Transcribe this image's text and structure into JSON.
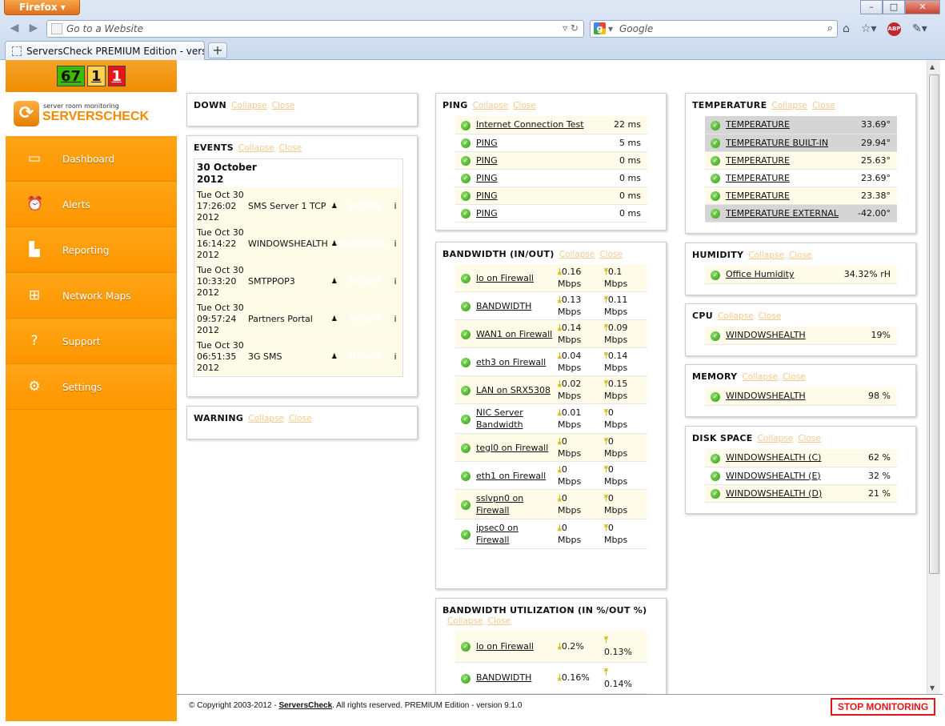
{
  "browser": {
    "menu_button": "Firefox",
    "url_placeholder": "Go to a Website",
    "search_placeholder": "Google",
    "tab_title": "ServersCheck PREMIUM Edition - versio...",
    "new_tab": "+",
    "abp": "ABP"
  },
  "counts": {
    "ok": "67",
    "warning": "1",
    "down": "1"
  },
  "logo": {
    "tagline": "server room monitoring",
    "name": "SERVERSCHECK"
  },
  "nav": [
    {
      "label": "Dashboard",
      "icon": "monitor-icon"
    },
    {
      "label": "Alerts",
      "icon": "alarm-clock-icon"
    },
    {
      "label": "Reporting",
      "icon": "bar-chart-icon"
    },
    {
      "label": "Network Maps",
      "icon": "network-icon"
    },
    {
      "label": "Support",
      "icon": "help-icon"
    },
    {
      "label": "Settings",
      "icon": "gear-icon"
    }
  ],
  "links": {
    "collapse": "Collapse",
    "close": "Close"
  },
  "down": {
    "title": "DOWN"
  },
  "events": {
    "title": "EVENTS",
    "date": "30 October 2012",
    "rows": [
      {
        "d1": "Tue Oct 30",
        "d2": "17:26:02",
        "d3": "2012",
        "name": "SMS Server 1 TCP",
        "status": "DOWN"
      },
      {
        "d1": "Tue Oct 30",
        "d2": "16:14:22",
        "d3": "2012",
        "name": "WINDOWSHEALTH",
        "status": "WARNING"
      },
      {
        "d1": "Tue Oct 30",
        "d2": "10:33:20",
        "d3": "2012",
        "name": "SMTPPOP3",
        "status": "DOWN"
      },
      {
        "d1": "Tue Oct 30",
        "d2": "09:57:24",
        "d3": "2012",
        "name": "Partners Portal",
        "status": "DOWN"
      },
      {
        "d1": "Tue Oct 30",
        "d2": "06:51:35",
        "d3": "2012",
        "name": "3G SMS",
        "status": "DOWN"
      }
    ],
    "info": "i"
  },
  "warning": {
    "title": "WARNING"
  },
  "ping": {
    "title": "PING",
    "rows": [
      {
        "name": "Internet Connection Test",
        "value": "22 ms"
      },
      {
        "name": "PING",
        "value": "5 ms"
      },
      {
        "name": "PING",
        "value": "0 ms"
      },
      {
        "name": "PING",
        "value": "0 ms"
      },
      {
        "name": "PING",
        "value": "0 ms"
      },
      {
        "name": "PING",
        "value": "0 ms"
      }
    ]
  },
  "bandwidth": {
    "title": "BANDWIDTH (IN/OUT)",
    "rows": [
      {
        "name1": "lo on Firewall",
        "name2": "",
        "in": "0.16",
        "out": "0.1",
        "unit": "Mbps"
      },
      {
        "name1": "BANDWIDTH",
        "name2": "",
        "in": "0.13",
        "out": "0.11",
        "unit": "Mbps"
      },
      {
        "name1": "WAN1 on Firewall",
        "name2": "",
        "in": "0.14",
        "out": "0.09",
        "unit": "Mbps"
      },
      {
        "name1": "eth3 on Firewall",
        "name2": "",
        "in": "0.04",
        "out": "0.14",
        "unit": "Mbps"
      },
      {
        "name1": "LAN on SRX5308",
        "name2": "",
        "in": "0.02",
        "out": "0.15",
        "unit": "Mbps"
      },
      {
        "name1": "NIC Server",
        "name2": "Bandwidth",
        "in": "0.01",
        "out": "0",
        "unit": "Mbps"
      },
      {
        "name1": "tegl0 on Firewall",
        "name2": "",
        "in": "0",
        "out": "0",
        "unit": "Mbps"
      },
      {
        "name1": "eth1 on Firewall",
        "name2": "",
        "in": "0",
        "out": "0",
        "unit": "Mbps"
      },
      {
        "name1": "sslvpn0 on",
        "name2": "Firewall",
        "in": "0",
        "out": "0",
        "unit": "Mbps"
      },
      {
        "name1": "ipsec0 on",
        "name2": "Firewall",
        "in": "0",
        "out": "0",
        "unit": "Mbps"
      }
    ]
  },
  "utilization": {
    "title": "BANDWIDTH UTILIZATION (IN %/OUT %)",
    "rows": [
      {
        "name": "lo on Firewall",
        "in": "0.2%",
        "out": "0.13%"
      },
      {
        "name": "BANDWIDTH",
        "in": "0.16%",
        "out": "0.14%"
      }
    ]
  },
  "temperature": {
    "title": "TEMPERATURE",
    "rows": [
      {
        "name": "TEMPERATURE",
        "value": "33.69°",
        "grey": true
      },
      {
        "name": "TEMPERATURE BUILT-IN",
        "value": "29.94°",
        "grey": true
      },
      {
        "name": "TEMPERATURE",
        "value": "25.63°",
        "grey": false
      },
      {
        "name": "TEMPERATURE",
        "value": "23.69°",
        "grey": false
      },
      {
        "name": "TEMPERATURE",
        "value": "23.38°",
        "grey": false
      },
      {
        "name": "TEMPERATURE EXTERNAL",
        "value": "-42.00°",
        "grey": true
      }
    ]
  },
  "humidity": {
    "title": "HUMIDITY",
    "rows": [
      {
        "name": "Office Humidity",
        "value": "34.32% rH"
      }
    ]
  },
  "cpu": {
    "title": "CPU",
    "rows": [
      {
        "name": "WINDOWSHEALTH",
        "value": "19%"
      }
    ]
  },
  "memory": {
    "title": "MEMORY",
    "rows": [
      {
        "name": "WINDOWSHEALTH",
        "value": "98 %"
      }
    ]
  },
  "disk": {
    "title": "DISK SPACE",
    "rows": [
      {
        "name": "WINDOWSHEALTH (C)",
        "value": "62 %"
      },
      {
        "name": "WINDOWSHEALTH (E)",
        "value": "32 %"
      },
      {
        "name": "WINDOWSHEALTH (D)",
        "value": "21 %"
      }
    ]
  },
  "footer": {
    "prefix": "© Copyright 2003-2012 - ",
    "brand": "ServersCheck",
    "suffix": ". All rights reserved. PREMIUM Edition - version 9.1.0",
    "stop": "STOP MONITORING"
  },
  "colors": {
    "sidebar": "#ff9d04",
    "down": "#e8141a",
    "warning": "#ffa000",
    "ok": "#3cbc00"
  }
}
